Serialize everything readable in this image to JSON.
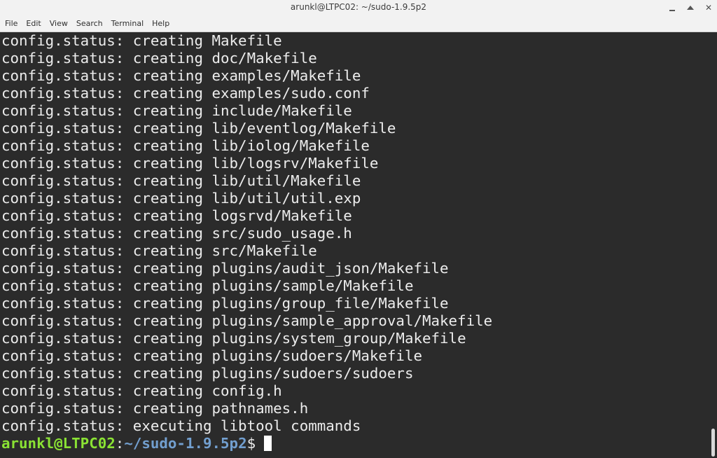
{
  "window": {
    "title": "arunkl@LTPC02: ~/sudo-1.9.5p2",
    "min_icon": "minimize-icon",
    "max_icon": "maximize-icon",
    "close_symbol": "✕"
  },
  "menu": [
    "File",
    "Edit",
    "View",
    "Search",
    "Terminal",
    "Help"
  ],
  "terminal": {
    "lines": [
      "config.status: creating Makefile",
      "config.status: creating doc/Makefile",
      "config.status: creating examples/Makefile",
      "config.status: creating examples/sudo.conf",
      "config.status: creating include/Makefile",
      "config.status: creating lib/eventlog/Makefile",
      "config.status: creating lib/iolog/Makefile",
      "config.status: creating lib/logsrv/Makefile",
      "config.status: creating lib/util/Makefile",
      "config.status: creating lib/util/util.exp",
      "config.status: creating logsrvd/Makefile",
      "config.status: creating src/sudo_usage.h",
      "config.status: creating src/Makefile",
      "config.status: creating plugins/audit_json/Makefile",
      "config.status: creating plugins/sample/Makefile",
      "config.status: creating plugins/group_file/Makefile",
      "config.status: creating plugins/sample_approval/Makefile",
      "config.status: creating plugins/system_group/Makefile",
      "config.status: creating plugins/sudoers/Makefile",
      "config.status: creating plugins/sudoers/sudoers",
      "config.status: creating config.h",
      "config.status: creating pathnames.h",
      "config.status: executing libtool commands"
    ],
    "prompt": {
      "user_host": "arunkl@LTPC02",
      "colon": ":",
      "path": "~/sudo-1.9.5p2",
      "dollar": "$"
    }
  },
  "colors": {
    "background": "#2b2b2b",
    "text": "#ececec",
    "prompt_user": "#8ae234",
    "prompt_path": "#729fcf"
  }
}
